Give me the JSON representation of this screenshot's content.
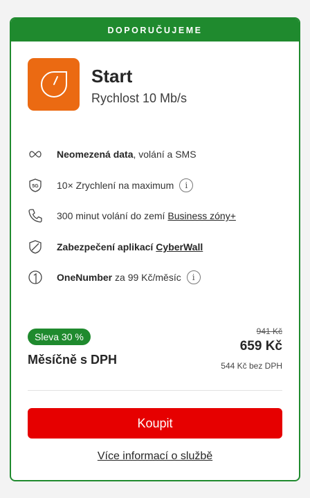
{
  "banner": "DOPORUČUJEME",
  "plan": {
    "name": "Start",
    "speed": "Rychlost 10 Mb/s",
    "accent": "#eb6a12"
  },
  "features": [
    {
      "icon": "infinity-icon",
      "bold": "Neomezená data",
      "text": ", volání a SMS"
    },
    {
      "icon": "5g-icon",
      "text": "10× Zrychlení na maximum",
      "info": "i"
    },
    {
      "icon": "phone-icon",
      "text": "300 minut volání do zemí",
      "link": "Business zóny+"
    },
    {
      "icon": "shield-icon",
      "bold": "Zabezpečení aplikací",
      "link": "CyberWall"
    },
    {
      "icon": "onenumber-icon",
      "bold": "OneNumber",
      "text": " za 99 Kč/měsíc",
      "info": "i"
    }
  ],
  "pricing": {
    "discount": "Sleva 30 %",
    "label": "Měsíčně s DPH",
    "old_price": "941 Kč",
    "price": "659 Kč",
    "price_no_vat": "544 Kč bez DPH"
  },
  "actions": {
    "buy": "Koupit",
    "more": "Více informací o službě"
  },
  "colors": {
    "green": "#1f8a2e",
    "red": "#e60000"
  }
}
